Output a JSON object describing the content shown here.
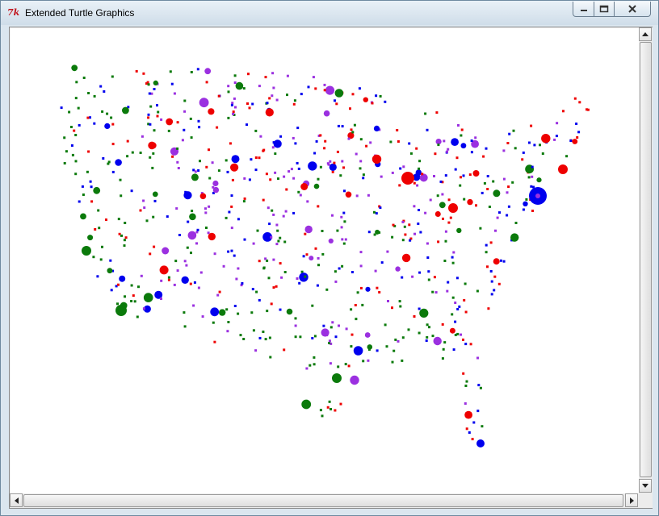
{
  "window": {
    "title": "Extended Turtle Graphics",
    "app_icon_text": "7k"
  },
  "controls": {
    "minimize_icon": "minimize-icon",
    "maximize_icon": "maximize-icon",
    "close_icon": "close-icon"
  },
  "colors": {
    "red": "#ee0000",
    "green": "#0b7a0b",
    "blue": "#0000ee",
    "purple": "#9b30e0"
  },
  "map": {
    "description_free": true
  }
}
